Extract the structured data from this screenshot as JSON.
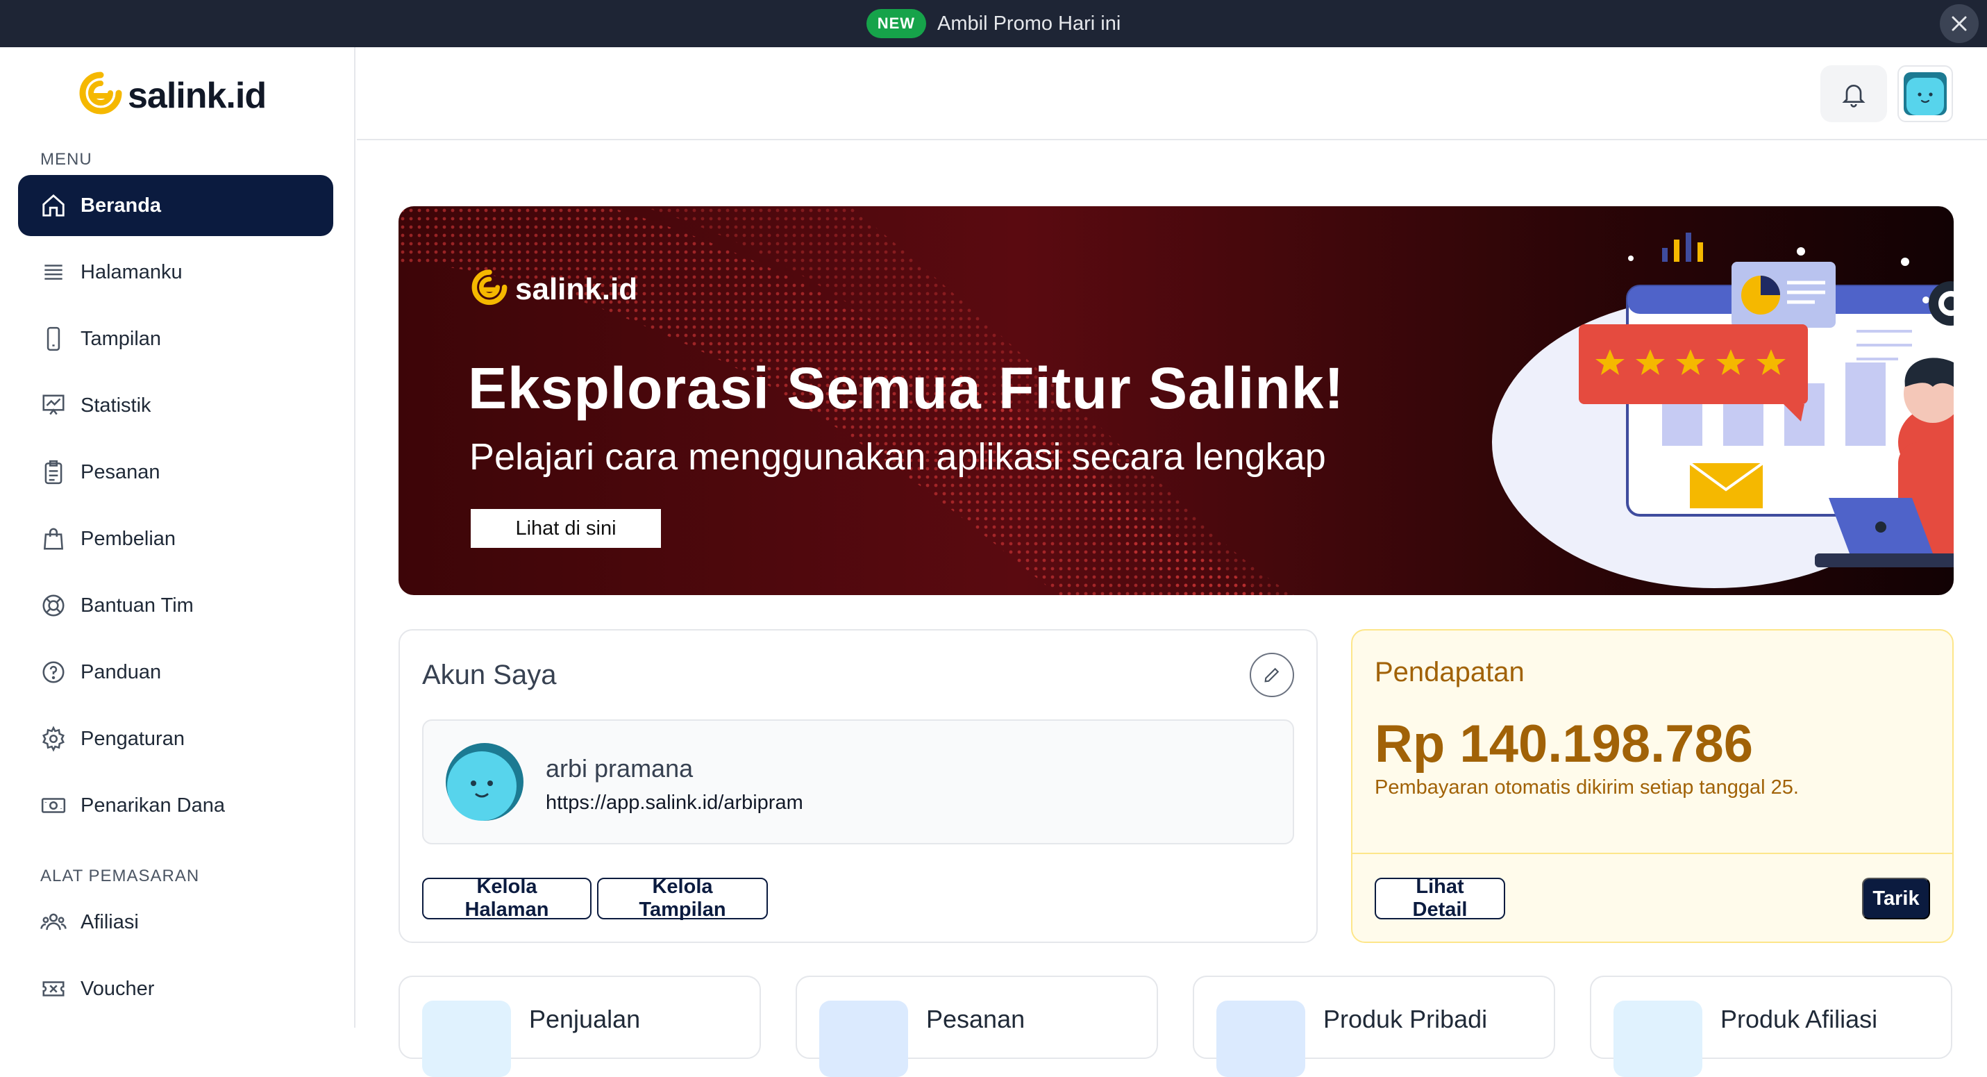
{
  "announcement": {
    "badge": "NEW",
    "text": "Ambil Promo Hari ini"
  },
  "brand": {
    "name": "salink.id"
  },
  "sidebar": {
    "section_menu": "MENU",
    "menu_items": [
      {
        "label": "Beranda",
        "icon": "home-icon",
        "active": true
      },
      {
        "label": "Halamanku",
        "icon": "list-icon"
      },
      {
        "label": "Tampilan",
        "icon": "phone-icon"
      },
      {
        "label": "Statistik",
        "icon": "chart-icon"
      },
      {
        "label": "Pesanan",
        "icon": "clipboard-icon"
      },
      {
        "label": "Pembelian",
        "icon": "bag-icon"
      },
      {
        "label": "Bantuan Tim",
        "icon": "lifebuoy-icon"
      },
      {
        "label": "Panduan",
        "icon": "help-icon"
      },
      {
        "label": "Pengaturan",
        "icon": "gear-icon"
      },
      {
        "label": "Penarikan Dana",
        "icon": "cash-icon"
      }
    ],
    "section_marketing": "ALAT PEMASARAN",
    "marketing_items": [
      {
        "label": "Afiliasi",
        "icon": "users-icon"
      },
      {
        "label": "Voucher",
        "icon": "ticket-icon"
      }
    ]
  },
  "banner": {
    "logo": "salink.id",
    "title": "Eksplorasi Semua Fitur Salink!",
    "subtitle": "Pelajari cara menggunakan aplikasi secara lengkap",
    "button": "Lihat di sini"
  },
  "account": {
    "title": "Akun Saya",
    "name": "arbi pramana",
    "url": "https://app.salink.id/arbipram",
    "btn_manage_page": "Kelola Halaman",
    "btn_manage_view": "Kelola Tampilan"
  },
  "income": {
    "title": "Pendapatan",
    "value": "Rp 140.198.786",
    "note": "Pembayaran otomatis dikirim setiap tanggal 25.",
    "btn_detail": "Lihat Detail",
    "btn_withdraw": "Tarik"
  },
  "stats": [
    {
      "label": "Penjualan"
    },
    {
      "label": "Pesanan"
    },
    {
      "label": "Produk Pribadi"
    },
    {
      "label": "Produk Afiliasi"
    }
  ],
  "colors": {
    "primary": "#0b1b3f",
    "accent": "#f5b800",
    "income": "#a16207"
  }
}
